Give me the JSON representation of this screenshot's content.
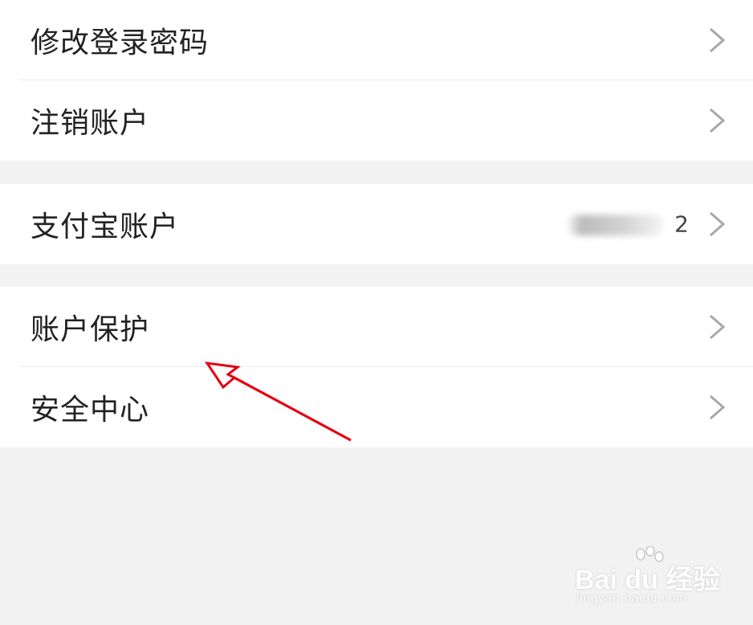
{
  "settings": {
    "group1": {
      "items": [
        {
          "label": "修改登录密码"
        },
        {
          "label": "注销账户"
        }
      ]
    },
    "group2": {
      "items": [
        {
          "label": "支付宝账户",
          "value_suffix": "2"
        }
      ]
    },
    "group3": {
      "items": [
        {
          "label": "账户保护"
        },
        {
          "label": "安全中心"
        }
      ]
    }
  },
  "icons": {
    "row_chevron": "chevron-right-icon",
    "annotation": "red-arrow-annotation",
    "watermark_logo": "baidu-paw-icon"
  },
  "colors": {
    "background": "#f2f2f2",
    "row_background": "#ffffff",
    "text": "#222222",
    "chevron": "#a8a8a8",
    "annotation_arrow": "#e60012"
  },
  "watermark": {
    "logo_text": "Bai du 经验",
    "url": "jingyan.baidu.com"
  }
}
